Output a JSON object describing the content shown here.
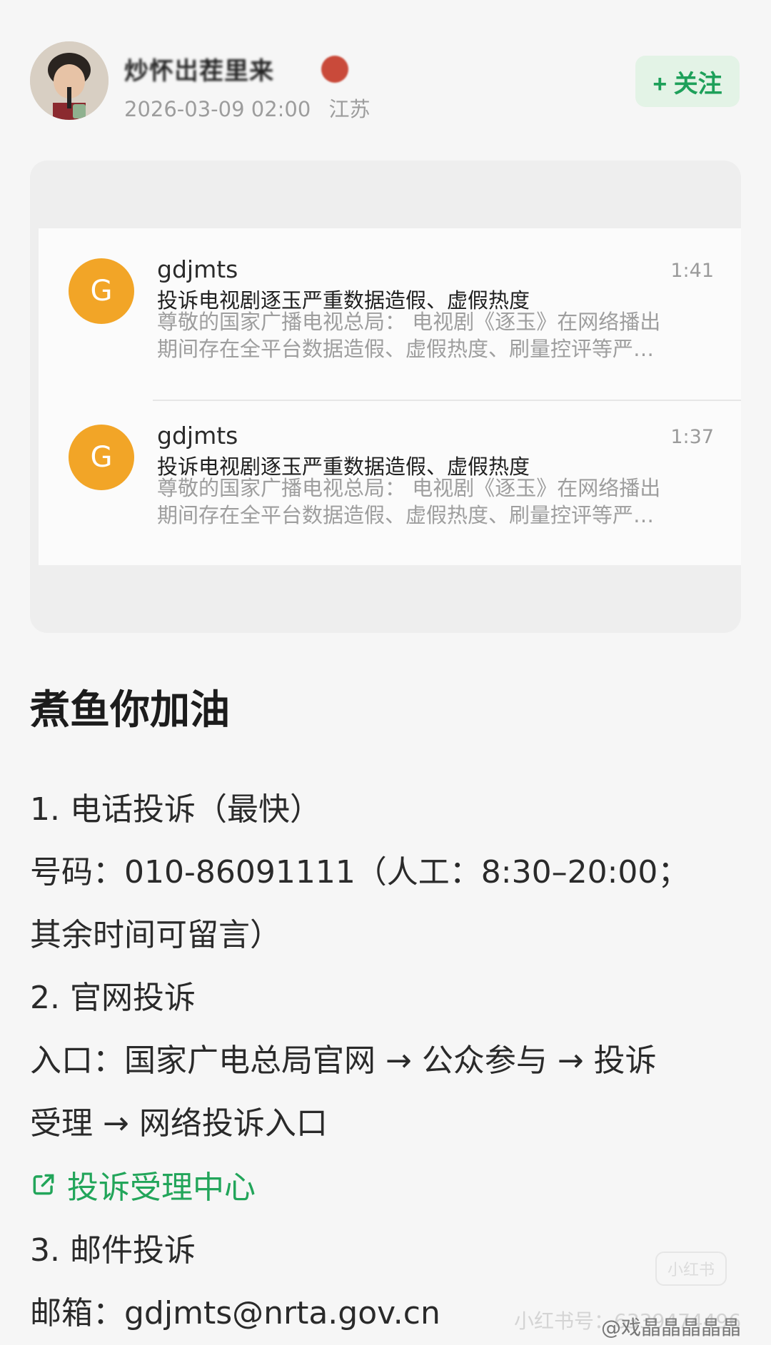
{
  "header": {
    "author_name": "炒怀岀茬里来",
    "post_date": "2026-03-09 02:00",
    "location": "江苏",
    "follow_label": "+ 关注"
  },
  "mails": [
    {
      "avatar_letter": "G",
      "sender": "gdjmts",
      "time": "1:41",
      "subject": "投诉电视剧逐玉严重数据造假、虚假热度",
      "preview_line1": "尊敬的国家广播电视总局： 电视剧《逐玉》在网络播出",
      "preview_line2": "期间存在全平台数据造假、虚假热度、刷量控评等严…"
    },
    {
      "avatar_letter": "G",
      "sender": "gdjmts",
      "time": "1:37",
      "subject": "投诉电视剧逐玉严重数据造假、虚假热度",
      "preview_line1": "尊敬的国家广播电视总局： 电视剧《逐玉》在网络播出",
      "preview_line2": "期间存在全平台数据造假、虚假热度、刷量控评等严…"
    }
  ],
  "post": {
    "title": "煮鱼你加油",
    "lines": [
      "1. 电话投诉（最快）",
      "号码：010-86091111（人工：8:30–20:00；",
      "其余时间可留言）",
      "2. 官网投诉",
      "入口：国家广电总局官网 → 公众参与 → 投诉",
      "受理 → 网络投诉入口",
      "3. 邮件投诉",
      "邮箱：gdjmts@nrta.gov.cn"
    ],
    "link_label": "投诉受理中心"
  },
  "overlay": {
    "xhs_id": "小红书号：6339474496",
    "xhs_badge": "小红书",
    "watermark": "@戏晶晶晶晶晶"
  },
  "colors": {
    "accent_green": "#22a55a",
    "follow_bg": "#e3f3e6",
    "mail_avatar": "#f2a527"
  }
}
